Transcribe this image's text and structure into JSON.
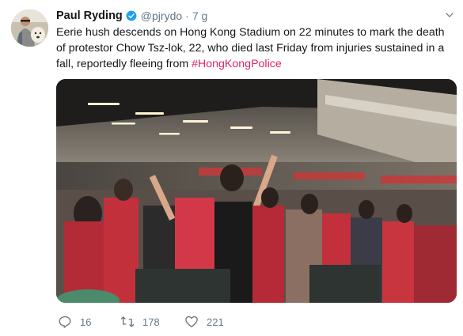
{
  "tweet": {
    "author_name": "Paul Ryding",
    "handle": "@pjrydo",
    "separator": "·",
    "time": "7 g",
    "text_main": "Eerie hush descends on Hong Kong Stadium on 22 minutes to mark the death of protestor Chow Tsz-lok, 22, who died last Friday from injuries sustained in a fall, reportedly fleeing from ",
    "hashtag": "#HongKongPolice",
    "media_description": "photo",
    "stats": {
      "replies": "16",
      "retweets": "178",
      "likes": "221"
    }
  },
  "colors": {
    "hashtag": "#e0245e",
    "secondary_text": "#657786",
    "verified": "#1da1f2"
  },
  "icons": [
    "verified-badge-icon",
    "chevron-down-icon",
    "reply-icon",
    "retweet-icon",
    "like-icon"
  ]
}
